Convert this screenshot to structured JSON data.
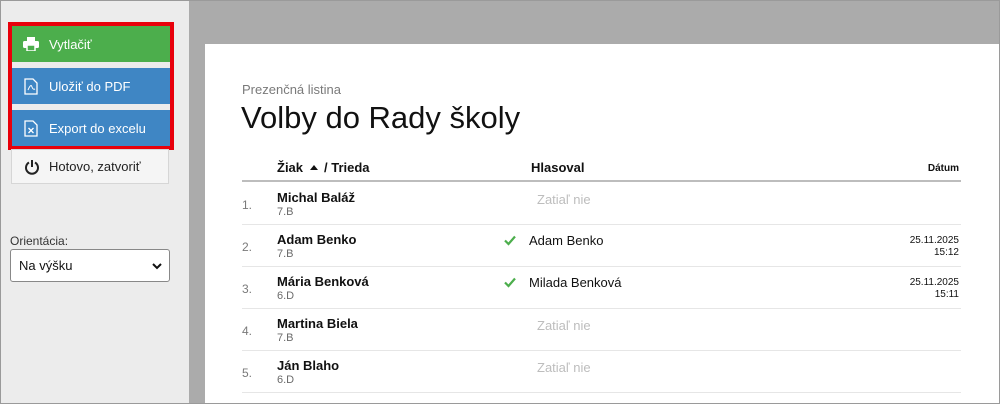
{
  "sidebar": {
    "print_label": "Vytlačiť",
    "pdf_label": "Uložiť do PDF",
    "excel_label": "Export do excelu",
    "done_label": "Hotovo, zatvoriť",
    "orientation_label": "Orientácia:",
    "orientation_value": "Na výšku"
  },
  "document": {
    "subtitle": "Prezenčná listina",
    "title": "Volby do Rady školy",
    "columns": {
      "student": "Žiak",
      "class": "/ Trieda",
      "voted": "Hlasoval",
      "date": "Dátum"
    },
    "rows": [
      {
        "num": "1.",
        "name": "Michal Baláž",
        "class": "7.B",
        "status": "Zatiaľ nie"
      },
      {
        "num": "2.",
        "name": "Adam Benko",
        "class": "7.B",
        "voter": "Adam Benko",
        "date": "25.11.2025",
        "time": "15:12"
      },
      {
        "num": "3.",
        "name": "Mária Benková",
        "class": "6.D",
        "voter": "Milada Benková",
        "date": "25.11.2025",
        "time": "15:11"
      },
      {
        "num": "4.",
        "name": "Martina Biela",
        "class": "7.B",
        "status": "Zatiaľ nie"
      },
      {
        "num": "5.",
        "name": "Ján Blaho",
        "class": "6.D",
        "status": "Zatiaľ nie"
      }
    ]
  },
  "colors": {
    "print": "#4cae4c",
    "secondary": "#3f86c4",
    "highlight_border": "#e8000b",
    "check": "#4cae4c"
  }
}
